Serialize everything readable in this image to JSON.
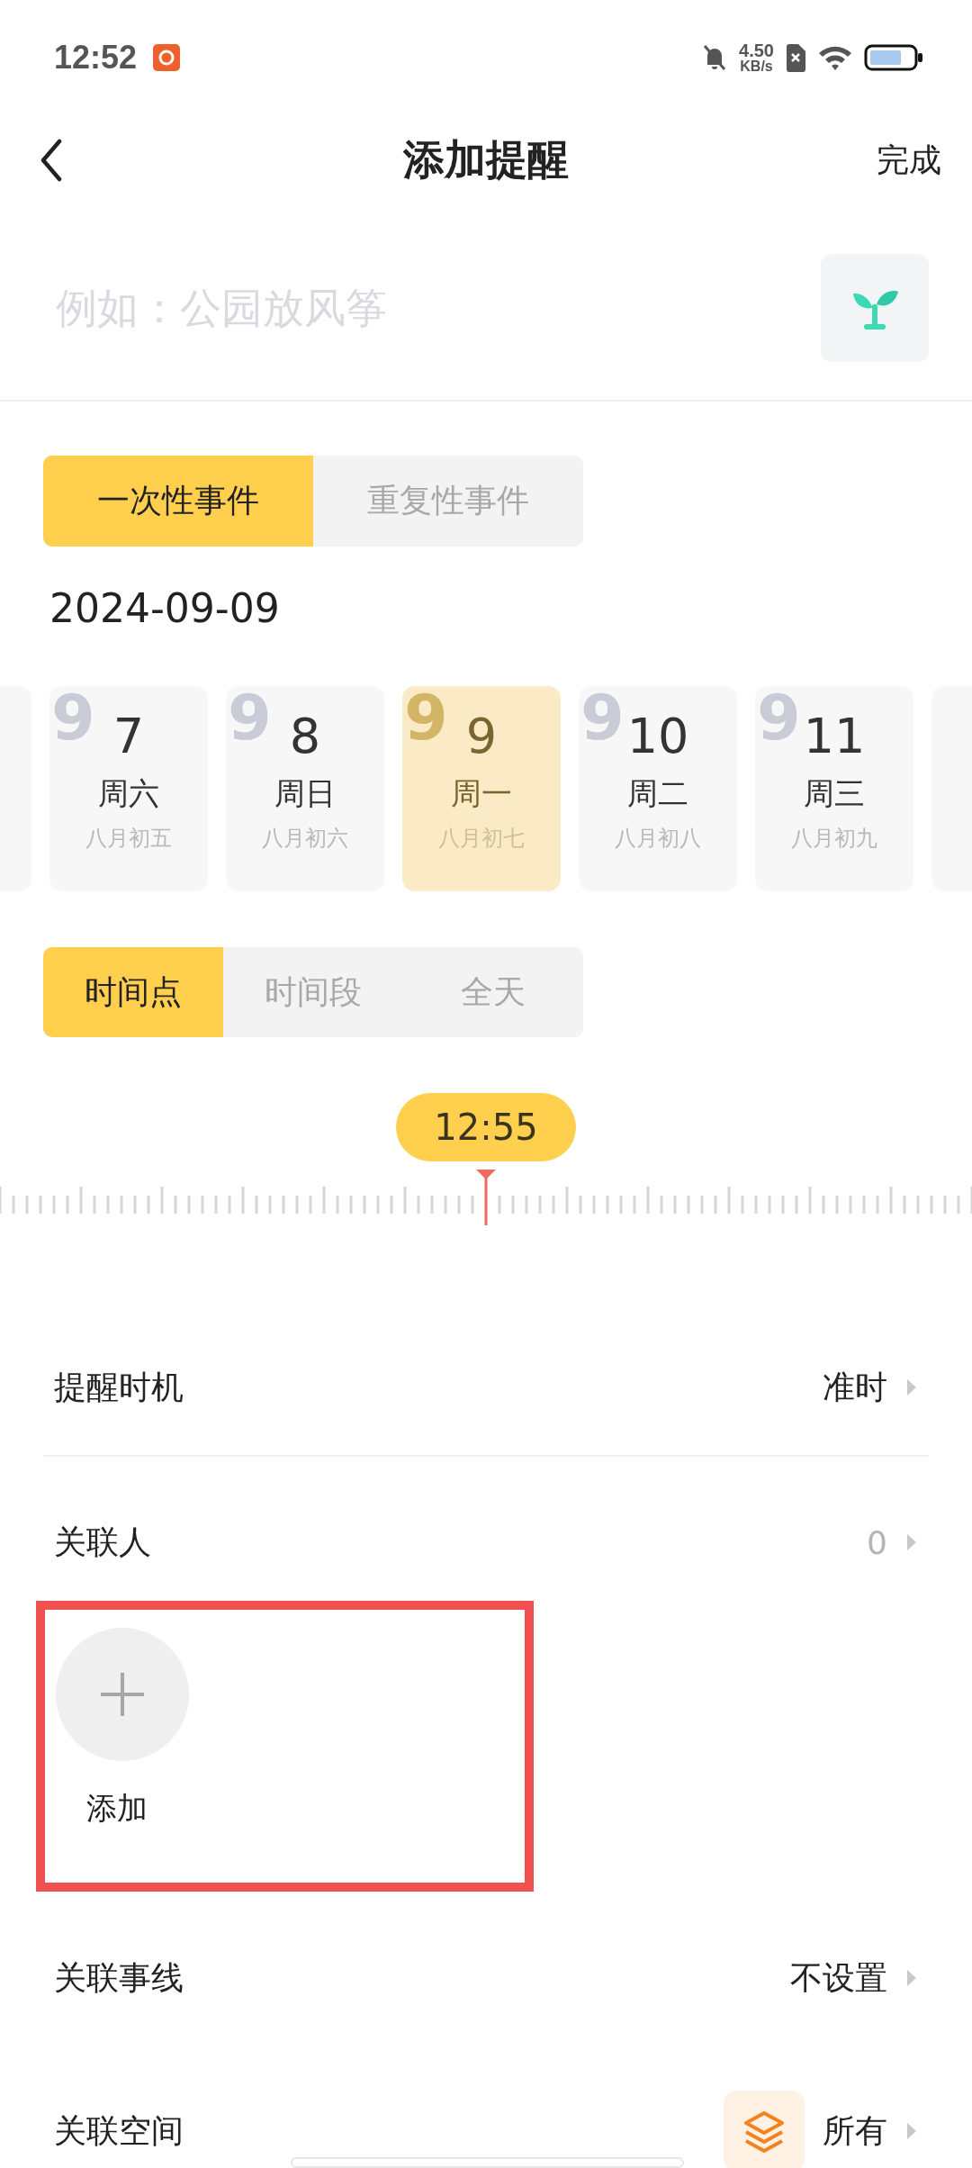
{
  "status_bar": {
    "time": "12:52",
    "net_speed_value": "4.50",
    "net_speed_unit": "KB/s"
  },
  "header": {
    "title": "添加提醒",
    "done": "完成"
  },
  "title_field": {
    "placeholder": "例如：公园放风筝"
  },
  "event_types": [
    {
      "label": "一次性事件",
      "selected": true
    },
    {
      "label": "重复性事件",
      "selected": false
    }
  ],
  "selected_date": "2024-09-09",
  "date_strip": [
    {
      "month": "9",
      "day": "7",
      "weekday": "周六",
      "lunar": "八月初五",
      "selected": false
    },
    {
      "month": "9",
      "day": "8",
      "weekday": "周日",
      "lunar": "八月初六",
      "selected": false
    },
    {
      "month": "9",
      "day": "9",
      "weekday": "周一",
      "lunar": "八月初七",
      "selected": true
    },
    {
      "month": "9",
      "day": "10",
      "weekday": "周二",
      "lunar": "八月初八",
      "selected": false
    },
    {
      "month": "9",
      "day": "11",
      "weekday": "周三",
      "lunar": "八月初九",
      "selected": false
    }
  ],
  "time_modes": [
    {
      "label": "时间点",
      "selected": true
    },
    {
      "label": "时间段",
      "selected": false
    },
    {
      "label": "全天",
      "selected": false
    }
  ],
  "time_picker": {
    "value": "12:55"
  },
  "settings": [
    {
      "kind": "value",
      "label": "提醒时机",
      "value": "准时"
    },
    {
      "kind": "count",
      "label": "关联人",
      "value": "0"
    },
    {
      "kind": "people",
      "add_label": "添加",
      "highlighted": true
    },
    {
      "kind": "value",
      "label": "关联事线",
      "value": "不设置"
    },
    {
      "kind": "space",
      "label": "关联空间",
      "value": "所有"
    }
  ]
}
